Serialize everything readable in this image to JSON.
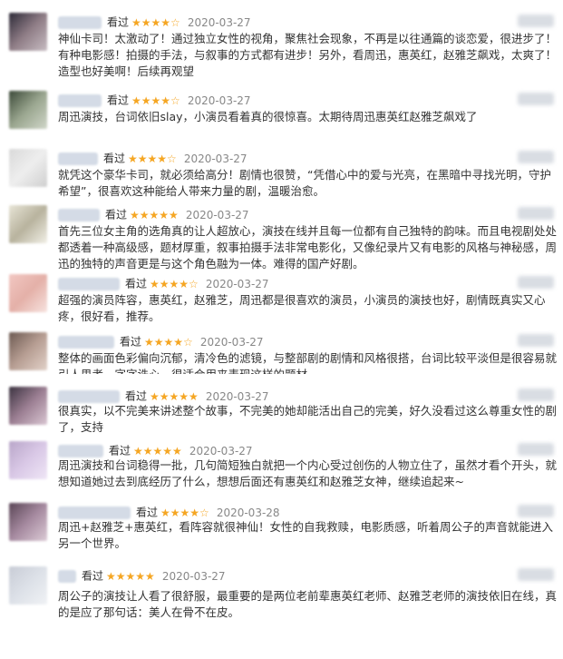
{
  "reviews": [
    {
      "status": "看过",
      "stars": "★★★★☆",
      "date": "2020-03-27",
      "text": "神仙卡司！太激动了！通过独立女性的视角，聚焦社会现象，不再是以往通篇的谈恋爱，很进步了！有种电影感！拍摄的手法，与叙事的方式都有进步！另外，看周迅，惠英红，赵雅芝飙戏，太爽了！造型也好美啊！后续再观望"
    },
    {
      "status": "看过",
      "stars": "★★★★☆",
      "date": "2020-03-27",
      "text": "周迅演技，台词依旧slay，小演员看着真的很惊喜。太期待周迅惠英红赵雅芝飙戏了"
    },
    {
      "status": "看过",
      "stars": "★★★★☆",
      "date": "2020-03-27",
      "text": "就凭这个豪华卡司，就必须给高分！剧情也很赞，“凭借心中的爱与光亮，在黑暗中寻找光明，守护希望”，很喜欢这种能给人带来力量的剧，温暖治愈。"
    },
    {
      "status": "看过",
      "stars": "★★★★★",
      "date": "2020-03-27",
      "text": "首先三位女主角的选角真的让人超放心，演技在线并且每一位都有自己独特的韵味。而且电视剧处处都透着一种高级感，题材厚重，叙事拍摄手法非常电影化，又像纪录片又有电影的风格与神秘感，周迅的独特的声音更是与这个角色融为一体。难得的国产好剧。"
    },
    {
      "status": "看过",
      "stars": "★★★★☆",
      "date": "2020-03-27",
      "text": "超强的演员阵容，惠英红，赵雅芝，周迅都是很喜欢的演员，小演员的演技也好，剧情既真实又心疼，很好看，推荐。"
    },
    {
      "status": "看过",
      "stars": "★★★★☆",
      "date": "2020-03-27",
      "text": "整体的画面色彩偏向沉郁，清冷色的滤镜，与整部剧的剧情和风格很搭，台词比较平淡但是很容易就引人思考，字字诛心，很适合用来表现这样的题材。"
    },
    {
      "status": "看过",
      "stars": "★★★★★",
      "date": "2020-03-27",
      "text": "很真实，以不完美来讲述整个故事，不完美的她却能活出自己的完美，好久没看过这么尊重女性的剧了，支持"
    },
    {
      "status": "看过",
      "stars": "★★★★★",
      "date": "2020-03-27",
      "text": "周迅演技和台词稳得一批，几句简短独白就把一个内心受过创伤的人物立住了，虽然才看个开头，就想知道她过去到底经历了什么，想想后面还有惠英红和赵雅芝女神，继续追起来~"
    },
    {
      "status": "看过",
      "stars": "★★★★☆",
      "date": "2020-03-28",
      "text": "周迅+赵雅芝+惠英红，看阵容就很神仙！女性的自我救赎，电影质感，听着周公子的声音就能进入另一个世界。"
    },
    {
      "status": "看过",
      "stars": "★★★★★",
      "date": "2020-03-27",
      "text": "周公子的演技让人看了很舒服，最重要的是两位老前辈惠英红老师、赵雅芝老师的演技依旧在线，真的是应了那句话：美人在骨不在皮。"
    }
  ]
}
